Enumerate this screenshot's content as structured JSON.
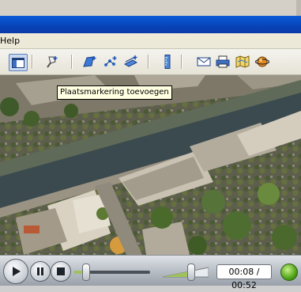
{
  "menu": {
    "help_label": "Help"
  },
  "toolbar": {
    "tooltip": "Plaatsmarkering toevoegen",
    "buttons": [
      {
        "name": "sidebar-toggle-icon"
      },
      {
        "name": "add-placemark-icon"
      },
      {
        "name": "add-polygon-icon"
      },
      {
        "name": "add-path-icon"
      },
      {
        "name": "add-image-overlay-icon"
      },
      {
        "name": "ruler-icon"
      },
      {
        "name": "email-icon"
      },
      {
        "name": "print-icon"
      },
      {
        "name": "maps-icon"
      },
      {
        "name": "planet-icon"
      }
    ]
  },
  "player": {
    "time": "00:08 / 00:52",
    "progress": 0.15,
    "volume": 0.6,
    "colors": {
      "progress": "#9fc35a",
      "orb": "#4fa417"
    }
  }
}
